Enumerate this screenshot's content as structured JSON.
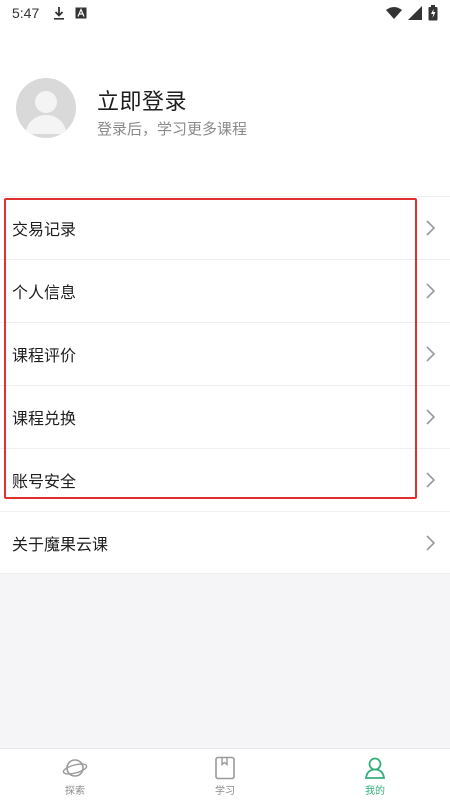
{
  "status_bar": {
    "time": "5:47",
    "icons_left": [
      "download-icon",
      "a-notification-icon"
    ],
    "icons_right": [
      "wifi-icon",
      "signal-icon",
      "battery-icon"
    ]
  },
  "profile": {
    "title": "立即登录",
    "subtitle": "登录后，学习更多课程"
  },
  "menu": {
    "items": [
      {
        "label": "交易记录"
      },
      {
        "label": "个人信息"
      },
      {
        "label": "课程评价"
      },
      {
        "label": "课程兑换"
      },
      {
        "label": "账号安全"
      },
      {
        "label": "关于魔果云课"
      }
    ]
  },
  "tabs": [
    {
      "label": "探索",
      "icon": "planet-icon",
      "active": false
    },
    {
      "label": "学习",
      "icon": "book-icon",
      "active": false
    },
    {
      "label": "我的",
      "icon": "user-icon",
      "active": true
    }
  ],
  "colors": {
    "accent": "#33b07a",
    "highlight": "#e0312e"
  }
}
